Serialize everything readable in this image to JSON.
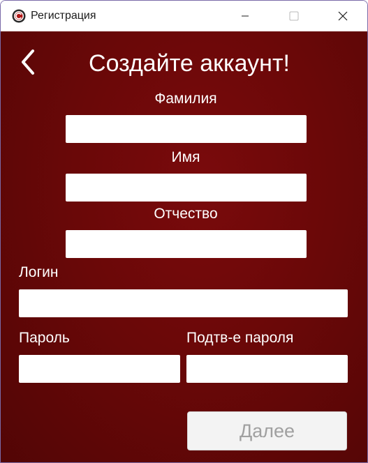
{
  "window": {
    "title": "Регистрация"
  },
  "form": {
    "heading": "Создайте аккаунт!",
    "surname_label": "Фамилия",
    "surname_value": "",
    "name_label": "Имя",
    "name_value": "",
    "patronymic_label": "Отчество",
    "patronymic_value": "",
    "login_label": "Логин",
    "login_value": "",
    "password_label": "Пароль",
    "password_value": "",
    "confirm_label": "Подтв-е пароля",
    "confirm_value": "",
    "next_label": "Далее"
  },
  "icons": {
    "app": "app-logo-icon",
    "back": "chevron-left-icon",
    "minimize": "minimize-icon",
    "maximize": "maximize-icon",
    "close": "close-icon"
  },
  "colors": {
    "background": "#6a0808",
    "field": "#ffffff",
    "button_disabled_text": "#a0a0a0"
  }
}
